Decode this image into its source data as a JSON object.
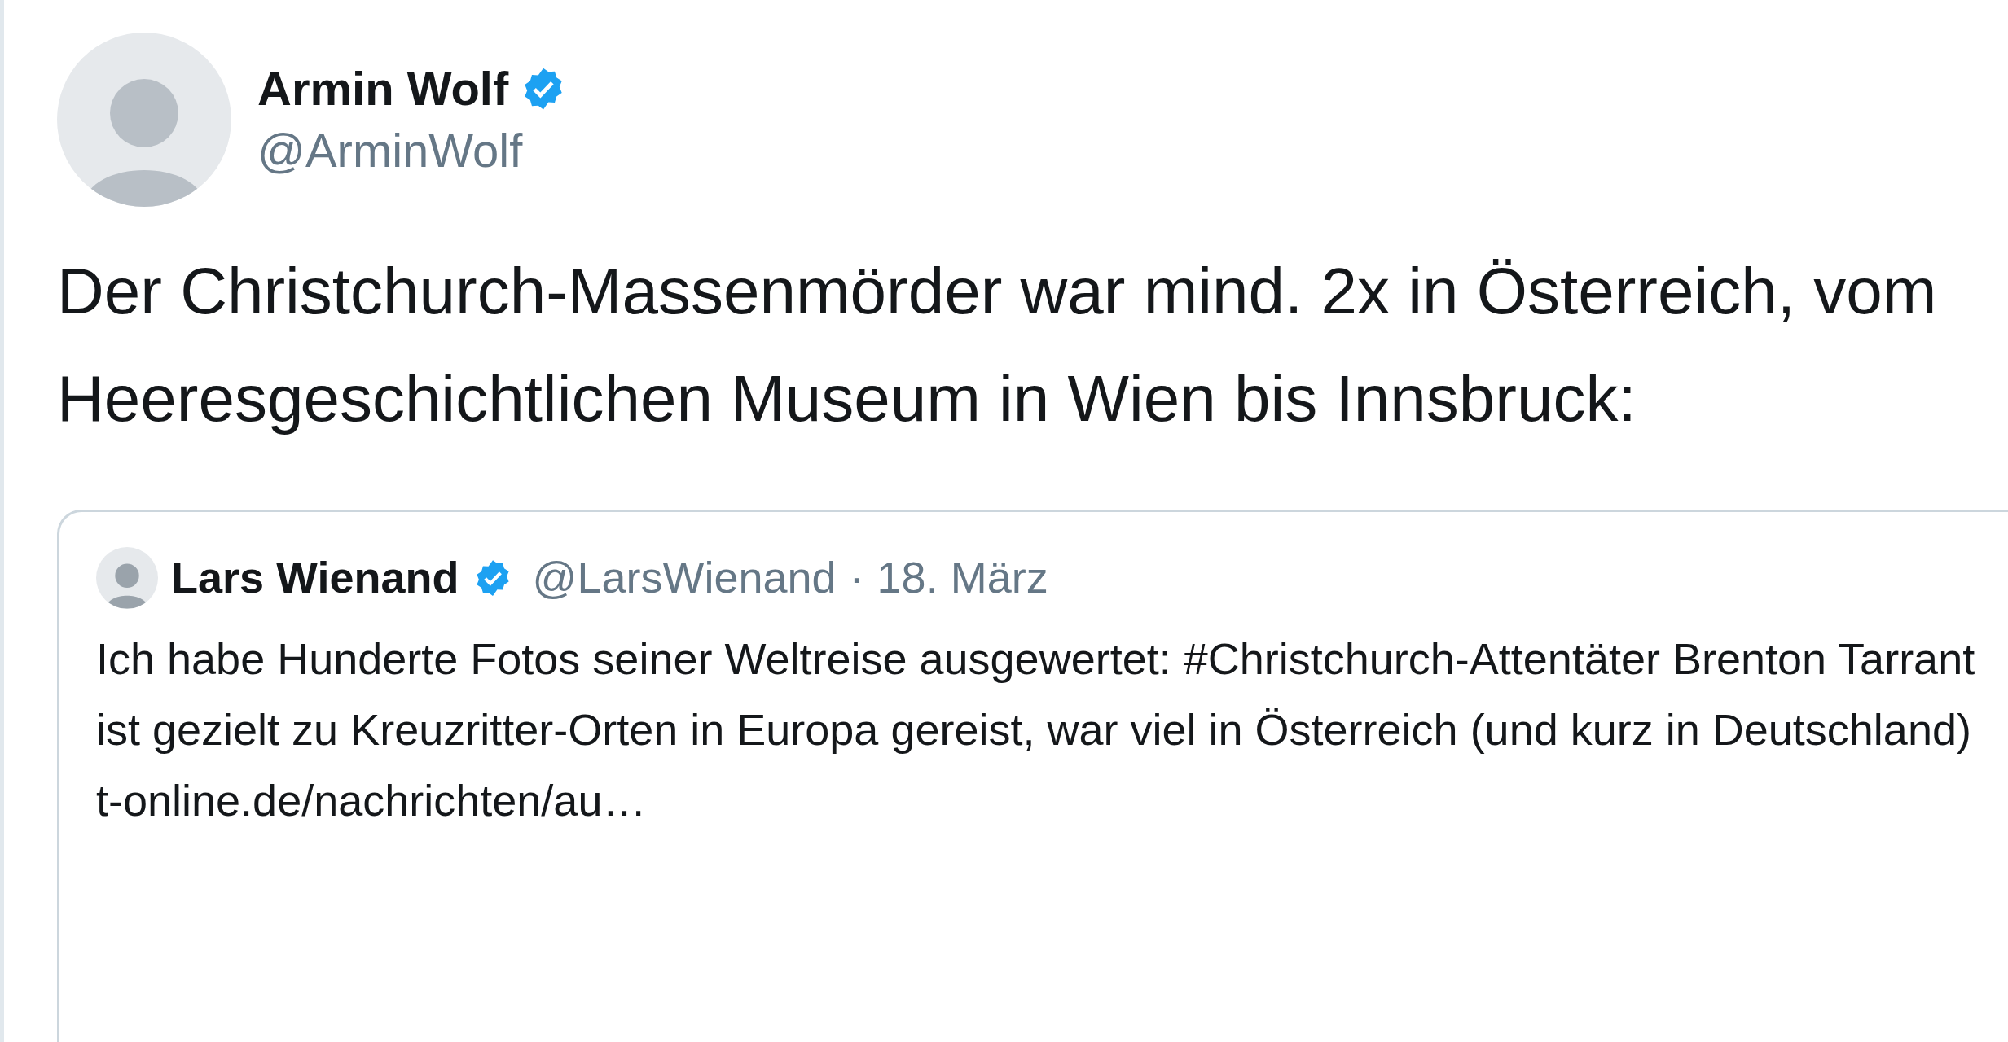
{
  "author": {
    "name": "Armin Wolf",
    "handle": "@ArminWolf",
    "verified": true
  },
  "text": "Der Christchurch-Massenmörder war mind. 2x in Österreich, vom Heeresgeschichtlichen Museum in Wien bis Innsbruck:",
  "quoted_tweet": {
    "author": {
      "name": "Lars Wienand",
      "handle": "@LarsWienand",
      "verified": true
    },
    "separator": "·",
    "date": "18. März",
    "text": "Ich habe Hunderte Fotos seiner Weltreise ausgewertet: #Christchurch-Attentäter Brenton Tarrant ist gezielt zu Kreuzritter-Orten in Europa gereist, war viel in Österreich (und kurz in Deutschland) t-online.de/nachrichten/au…"
  }
}
